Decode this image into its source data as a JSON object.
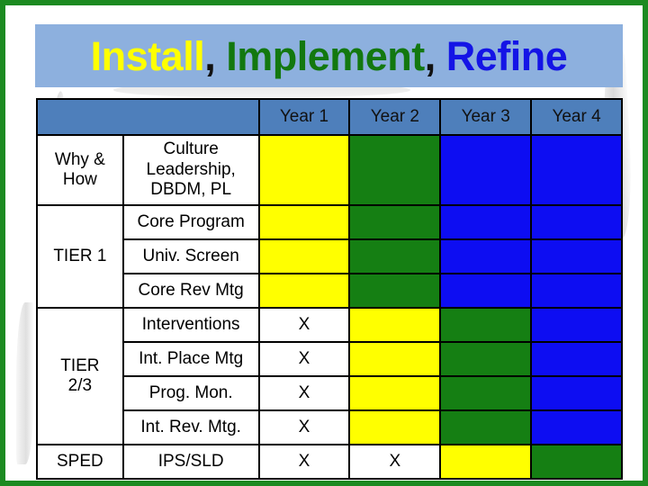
{
  "slide": {
    "border_color": "#1C8A21",
    "background": "#FFFFFF"
  },
  "title": {
    "banner_color": "#8DB0DE",
    "parts": [
      {
        "text": "Install",
        "color": "#FFFF00"
      },
      {
        "text": ", ",
        "color": "#111111"
      },
      {
        "text": "Implement",
        "color": "#13780F"
      },
      {
        "text": ", ",
        "color": "#111111"
      },
      {
        "text": "Refine",
        "color": "#1414E6"
      }
    ],
    "plain": "Install, Implement, Refine"
  },
  "legend_colors": {
    "header_blue": "#4E7FBB",
    "row_tint": "#D3DAE9",
    "yellow": "#FFFF00",
    "green": "#157F13",
    "blue": "#0D0DF2",
    "mark": "X"
  },
  "table": {
    "headers": {
      "category": "",
      "item": "",
      "years": [
        "Year 1",
        "Year 2",
        "Year 3",
        "Year 4"
      ]
    },
    "groups": [
      {
        "category": "Why & How",
        "rowspan": 1,
        "tinted": true,
        "rows": [
          {
            "item": "Culture Leadership, DBDM, PL",
            "item_lines": [
              "Culture",
              "Leadership,",
              "DBDM, PL"
            ],
            "cells": [
              "yellow",
              "green",
              "blue",
              "blue"
            ]
          }
        ]
      },
      {
        "category": "TIER 1",
        "rowspan": 3,
        "tinted": false,
        "rows": [
          {
            "item": "Core Program",
            "cells": [
              "yellow",
              "green",
              "blue",
              "blue"
            ]
          },
          {
            "item": "Univ. Screen",
            "cells": [
              "yellow",
              "green",
              "blue",
              "blue"
            ]
          },
          {
            "item": "Core Rev Mtg",
            "cells": [
              "yellow",
              "green",
              "blue",
              "blue"
            ]
          }
        ]
      },
      {
        "category": "TIER 2/3",
        "category_lines": [
          "TIER",
          "2/3"
        ],
        "rowspan": 4,
        "tinted": false,
        "rows": [
          {
            "item": "Interventions",
            "cells": [
              "X",
              "yellow",
              "green",
              "blue"
            ]
          },
          {
            "item": "Int. Place Mtg",
            "cells": [
              "X",
              "yellow",
              "green",
              "blue"
            ]
          },
          {
            "item": "Prog. Mon.",
            "cells": [
              "X",
              "yellow",
              "green",
              "blue"
            ]
          },
          {
            "item": "Int. Rev. Mtg.",
            "cells": [
              "X",
              "yellow",
              "green",
              "blue"
            ]
          }
        ]
      },
      {
        "category": "SPED",
        "rowspan": 1,
        "tinted": false,
        "rows": [
          {
            "item": "IPS/SLD",
            "cells": [
              "X",
              "X",
              "yellow",
              "green"
            ]
          }
        ]
      }
    ]
  }
}
